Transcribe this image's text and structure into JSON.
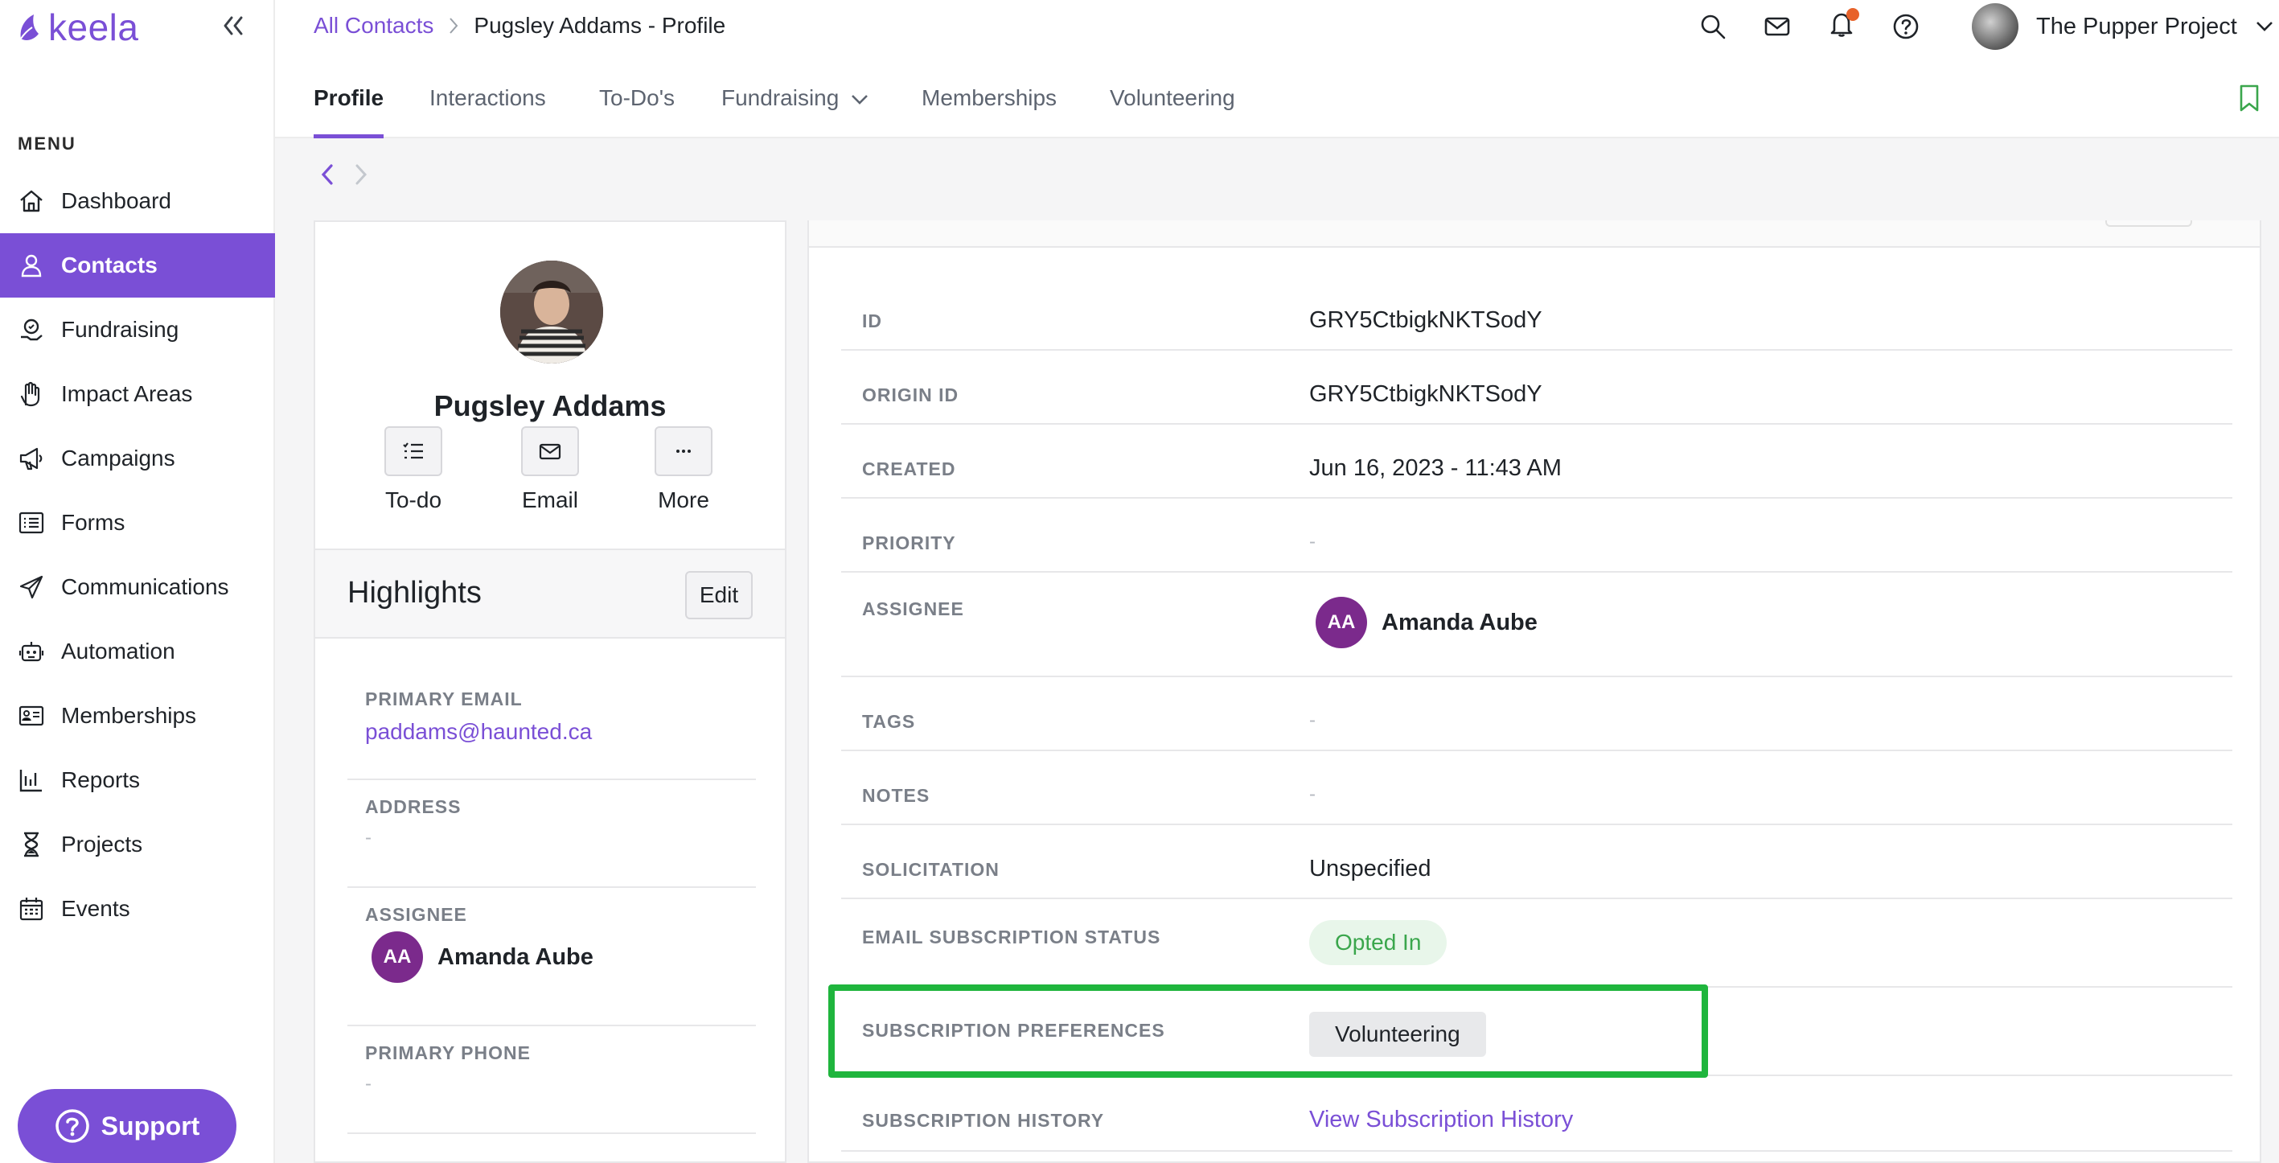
{
  "app": {
    "logo": "keela"
  },
  "sidebar": {
    "menu_label": "MENU",
    "items": [
      {
        "label": "Dashboard",
        "icon": "home-icon",
        "active": false
      },
      {
        "label": "Contacts",
        "icon": "person-icon",
        "active": true
      },
      {
        "label": "Fundraising",
        "icon": "fundraising-icon",
        "active": false
      },
      {
        "label": "Impact Areas",
        "icon": "hand-icon",
        "active": false
      },
      {
        "label": "Campaigns",
        "icon": "megaphone-icon",
        "active": false
      },
      {
        "label": "Forms",
        "icon": "list-icon",
        "active": false
      },
      {
        "label": "Communications",
        "icon": "paper-plane-icon",
        "active": false
      },
      {
        "label": "Automation",
        "icon": "robot-icon",
        "active": false
      },
      {
        "label": "Memberships",
        "icon": "id-card-icon",
        "active": false
      },
      {
        "label": "Reports",
        "icon": "bar-chart-icon",
        "active": false
      },
      {
        "label": "Projects",
        "icon": "hourglass-icon",
        "active": false
      },
      {
        "label": "Events",
        "icon": "calendar-icon",
        "active": false
      }
    ],
    "support_label": "Support"
  },
  "header": {
    "breadcrumb_link": "All Contacts",
    "breadcrumb_current": "Pugsley Addams - Profile",
    "org_name": "The Pupper Project"
  },
  "tabs": [
    {
      "label": "Profile",
      "active": true
    },
    {
      "label": "Interactions",
      "active": false
    },
    {
      "label": "To-Do's",
      "active": false
    },
    {
      "label": "Fundraising",
      "active": false,
      "dropdown": true
    },
    {
      "label": "Memberships",
      "active": false
    },
    {
      "label": "Volunteering",
      "active": false
    }
  ],
  "contact": {
    "name": "Pugsley Addams",
    "actions": {
      "todo": "To-do",
      "email": "Email",
      "more": "More"
    }
  },
  "highlights": {
    "title": "Highlights",
    "edit_label": "Edit",
    "primary_email_label": "PRIMARY EMAIL",
    "primary_email": "paddams@haunted.ca",
    "address_label": "ADDRESS",
    "address": "-",
    "assignee_label": "ASSIGNEE",
    "assignee_initials": "AA",
    "assignee_name": "Amanda Aube",
    "primary_phone_label": "PRIMARY PHONE",
    "primary_phone": "-"
  },
  "details": {
    "id_label": "ID",
    "id": "GRY5CtbigkNKTSodY",
    "origin_id_label": "ORIGIN ID",
    "origin_id": "GRY5CtbigkNKTSodY",
    "created_label": "CREATED",
    "created": "Jun 16, 2023 - 11:43 AM",
    "priority_label": "PRIORITY",
    "priority": "-",
    "assignee_label": "ASSIGNEE",
    "assignee_initials": "AA",
    "assignee_name": "Amanda Aube",
    "tags_label": "TAGS",
    "tags": "-",
    "notes_label": "NOTES",
    "notes": "-",
    "solicitation_label": "SOLICITATION",
    "solicitation": "Unspecified",
    "email_sub_status_label": "EMAIL SUBSCRIPTION STATUS",
    "email_sub_status": "Opted In",
    "sub_prefs_label": "SUBSCRIPTION PREFERENCES",
    "sub_prefs": "Volunteering",
    "sub_history_label": "SUBSCRIPTION HISTORY",
    "sub_history_link": "View Subscription History"
  },
  "colors": {
    "accent": "#7a4fd6",
    "opted_in": "#3aa64c",
    "highlight_box": "#1fb53d",
    "assignee_avatar": "#7b2a8c"
  }
}
